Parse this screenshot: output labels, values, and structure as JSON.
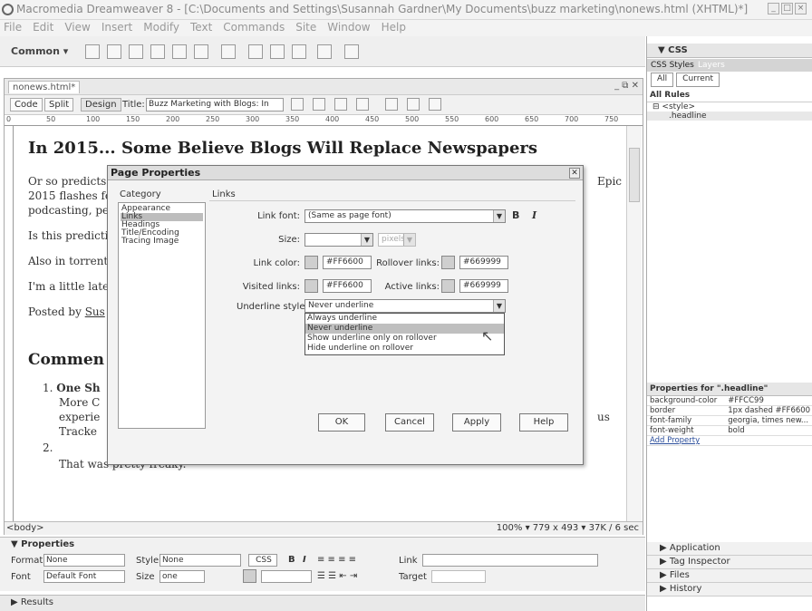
{
  "window": {
    "title": "Macromedia Dreamweaver 8 - [C:\\Documents and Settings\\Susannah Gardner\\My Documents\\buzz marketing\\nonews.html (XHTML)*]"
  },
  "menu": [
    "File",
    "Edit",
    "View",
    "Insert",
    "Modify",
    "Text",
    "Commands",
    "Site",
    "Window",
    "Help"
  ],
  "insertbar": {
    "category": "Common ▾"
  },
  "document": {
    "tab": "nonews.html*",
    "views": {
      "code": "Code",
      "split": "Split",
      "design": "Design"
    },
    "title_label": "Title:",
    "title_value": "Buzz Marketing with Blogs: In",
    "ruler_ticks": [
      "0",
      "50",
      "100",
      "150",
      "200",
      "250",
      "300",
      "350",
      "400",
      "450",
      "500",
      "550",
      "600",
      "650",
      "700",
      "750"
    ],
    "headline": "In 2015... Some Believe Blogs Will Replace Newspapers",
    "lines": [
      "Or so predicts",
      "2015 flashes fo",
      "podcasting, pe",
      "Is this predictio",
      "Also in torrent",
      "I'm a little late",
      "Posted by"
    ],
    "posted_link": "Sus",
    "epic_word": "Epic",
    "comments_heading": "Commen",
    "comment1_title": "One Sh",
    "comment1_lines": [
      "More C",
      "experie",
      "Tracke"
    ],
    "comment1_us": "us",
    "comment2_text": "That was pretty freaky.",
    "status_tag": "<body>",
    "status_info": "100%  ▾  779 x 493 ▾  37K / 6 sec"
  },
  "dialog": {
    "title": "Page Properties",
    "category_label": "Category",
    "section_label": "Links",
    "categories": [
      "Appearance",
      "Links",
      "Headings",
      "Title/Encoding",
      "Tracing Image"
    ],
    "selected_category": "Links",
    "link_font_label": "Link font:",
    "link_font_value": "(Same as page font)",
    "size_label": "Size:",
    "size_unit": "pixels",
    "link_color_label": "Link color:",
    "link_color_value": "#FF6600",
    "rollover_label": "Rollover links:",
    "rollover_value": "#669999",
    "visited_label": "Visited links:",
    "visited_value": "#FF6600",
    "active_label": "Active links:",
    "active_value": "#669999",
    "underline_label": "Underline style:",
    "underline_value": "Never underline",
    "underline_options": [
      "Always underline",
      "Never underline",
      "Show underline only on rollover",
      "Hide underline on rollover"
    ],
    "underline_highlighted": "Never underline",
    "buttons": {
      "ok": "OK",
      "cancel": "Cancel",
      "apply": "Apply",
      "help": "Help"
    }
  },
  "properties": {
    "header": "▼ Properties",
    "format_label": "Format",
    "format_value": "None",
    "style_label": "Style",
    "style_value": "None",
    "css_btn": "CSS",
    "link_label": "Link",
    "font_label": "Font",
    "font_value": "Default Font",
    "size_label": "Size",
    "size_value": "one",
    "target_label": "Target"
  },
  "results": "▶ Results",
  "panel": {
    "css_header": "▼ CSS",
    "tabs": [
      "CSS Styles",
      "Layers"
    ],
    "toggle": [
      "All",
      "Current"
    ],
    "all_rules": "All Rules",
    "rule_root": "<style>",
    "rule_child": ".headline",
    "props_title": "Properties for \".headline\"",
    "props": [
      {
        "name": "background-color",
        "value": "#FFCC99"
      },
      {
        "name": "border",
        "value": "1px dashed #FF6600"
      },
      {
        "name": "font-family",
        "value": "georgia, times new..."
      },
      {
        "name": "font-weight",
        "value": "bold"
      },
      {
        "name": "Add Property",
        "value": ""
      }
    ],
    "collapsed": [
      "▶ Application",
      "▶ Tag Inspector",
      "▶ Files",
      "▶ History"
    ]
  }
}
